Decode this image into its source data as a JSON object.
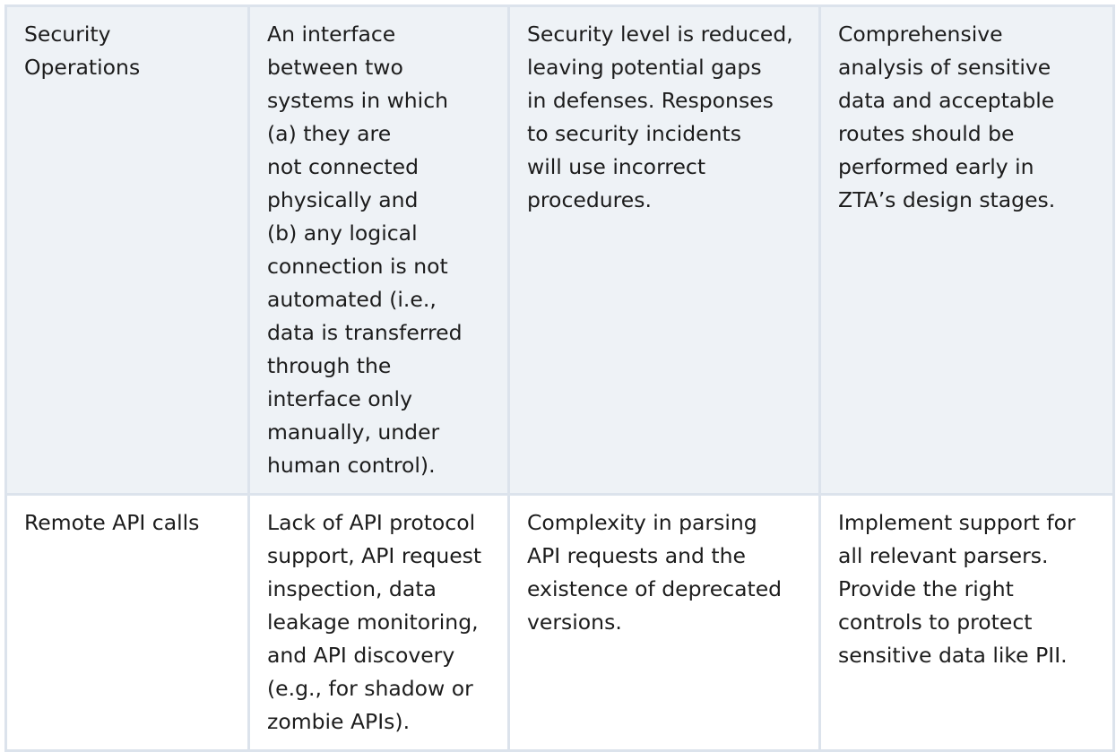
{
  "rows": [
    {
      "topic": [
        "Security",
        "Operations"
      ],
      "challenge": [
        "An interface",
        "between two",
        "systems in which",
        "(a) they are",
        "not connected",
        "physically and",
        "(b) any logical",
        "connection is not",
        "automated (i.e.,",
        "data is transferred",
        "through the",
        "interface only",
        "manually, under",
        "human control)."
      ],
      "impact": [
        "Security level is reduced,",
        "leaving potential gaps",
        "in defenses. Responses",
        "to security incidents",
        "will use incorrect",
        "procedures."
      ],
      "recommendation": [
        "Comprehensive",
        "analysis of sensitive",
        "data and acceptable",
        "routes should be",
        "performed early in",
        "ZTA’s design stages."
      ]
    },
    {
      "topic": [
        "Remote API calls"
      ],
      "challenge": [
        "Lack of API protocol",
        "support, API request",
        "inspection, data",
        "leakage monitoring,",
        "and API discovery",
        "(e.g., for shadow or",
        "zombie APIs)."
      ],
      "impact": [
        "Complexity in parsing",
        "API requests and the",
        "existence of deprecated",
        "versions."
      ],
      "recommendation": [
        "Implement support for",
        "all relevant parsers.",
        "Provide the right",
        "controls to protect",
        "sensitive data like PII."
      ]
    }
  ]
}
